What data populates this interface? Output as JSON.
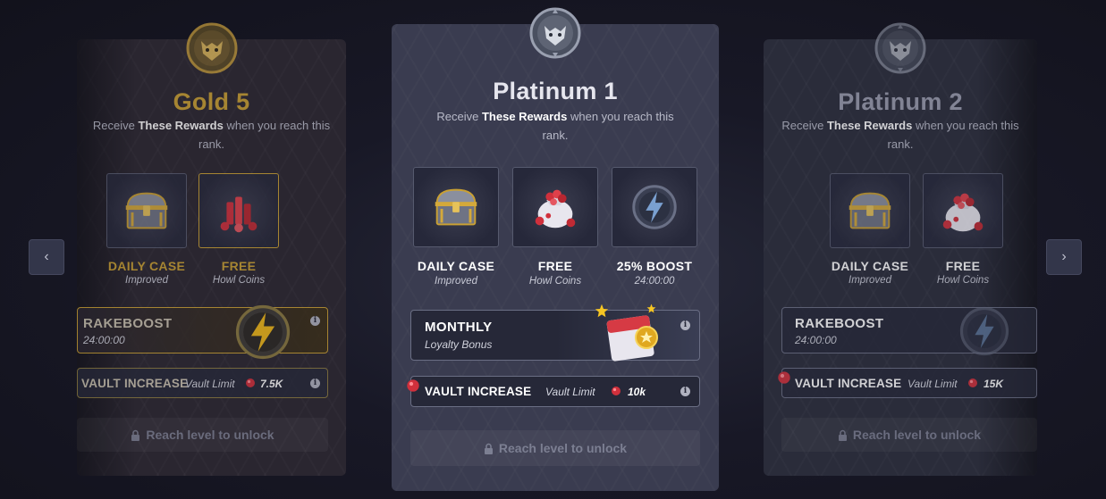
{
  "nav": {
    "prev_label": "‹",
    "next_label": "›"
  },
  "cards": [
    {
      "title": "Gold 5",
      "title_color": "#c9a033",
      "subtitle_pre": "Receive ",
      "subtitle_bold": "These Rewards",
      "subtitle_post": " when you reach this rank.",
      "rewards": [
        {
          "label": "DAILY CASE",
          "note": "Improved",
          "icon": "treasure-chest-icon",
          "label_color": "#c9a033"
        },
        {
          "label": "FREE",
          "note": "Howl Coins",
          "icon": "coins-icon",
          "label_color": "#c9a033"
        }
      ],
      "perk": {
        "title": "RAKEBOOST",
        "sub": "24:00:00",
        "icon": "lightning-coin-icon"
      },
      "vault": {
        "label": "VAULT INCREASE",
        "limit_label": "Vault Limit",
        "value": "7.5K"
      },
      "unlock_label": "Reach level to unlock"
    },
    {
      "title": "Platinum 1",
      "title_color": "#e6e6ee",
      "subtitle_pre": "Receive ",
      "subtitle_bold": "These Rewards",
      "subtitle_post": " when you reach this rank.",
      "rewards": [
        {
          "label": "DAILY CASE",
          "note": "Improved",
          "icon": "treasure-chest-icon"
        },
        {
          "label": "FREE",
          "note": "Howl Coins",
          "icon": "coin-bag-icon"
        },
        {
          "label": "25% BOOST",
          "note": "24:00:00",
          "icon": "lightning-coin-icon"
        }
      ],
      "perk": {
        "title": "MONTHLY",
        "sub": "Loyalty Bonus",
        "icon": "calendar-star-icon"
      },
      "vault": {
        "label": "VAULT INCREASE",
        "limit_label": "Vault Limit",
        "value": "10k"
      },
      "unlock_label": "Reach level to unlock"
    },
    {
      "title": "Platinum 2",
      "title_color": "#9a9cae",
      "subtitle_pre": "Receive ",
      "subtitle_bold": "These Rewards",
      "subtitle_post": " when you reach this rank.",
      "rewards": [
        {
          "label": "DAILY CASE",
          "note": "Improved",
          "icon": "treasure-chest-icon"
        },
        {
          "label": "FREE",
          "note": "Howl Coins",
          "icon": "coin-bag-icon"
        }
      ],
      "perk": {
        "title": "RAKEBOOST",
        "sub": "24:00:00",
        "icon": "lightning-coin-icon"
      },
      "vault": {
        "label": "VAULT INCREASE",
        "limit_label": "Vault Limit",
        "value": "15K"
      },
      "unlock_label": "Reach level to unlock"
    }
  ]
}
